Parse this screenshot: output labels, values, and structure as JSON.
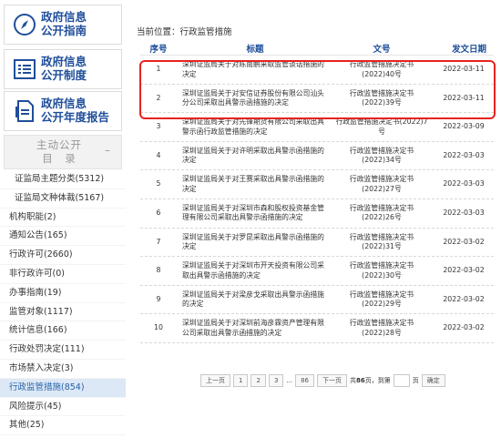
{
  "sidebar": {
    "guide": {
      "line1": "政府信息",
      "line2": "公开指南",
      "icon": "compass-icon"
    },
    "system": {
      "line1": "政府信息",
      "line2": "公开制度",
      "icon": "list-icon"
    },
    "report": {
      "line1": "政府信息",
      "line2": "公开年度报告",
      "icon": "document-icon"
    },
    "catalog": {
      "line1": "主动公开",
      "line2": "目　录",
      "collapse": "–"
    },
    "items": [
      {
        "label": "证监局主题分类(5312)"
      },
      {
        "label": "证监局文种体裁(5167)"
      },
      {
        "label": "机构职能(2)"
      },
      {
        "label": "通知公告(165)"
      },
      {
        "label": "行政许可(2660)"
      },
      {
        "label": "非行政许可(0)"
      },
      {
        "label": "办事指南(19)"
      },
      {
        "label": "监管对象(1117)"
      },
      {
        "label": "统计信息(166)"
      },
      {
        "label": "行政处罚决定(111)"
      },
      {
        "label": "市场禁入决定(3)"
      },
      {
        "label": "行政监管措施(854)"
      },
      {
        "label": "风险提示(45)"
      },
      {
        "label": "其他(25)"
      }
    ]
  },
  "breadcrumb": "当前位置：行政监管措施",
  "table": {
    "headers": {
      "no": "序号",
      "title": "标题",
      "doc": "文号",
      "date": "发文日期"
    },
    "rows": [
      {
        "no": "1",
        "title": "深圳证监局关于对陈南鹏采取监管谈话措施的决定",
        "doc": "行政监管措施决定书(2022)40号",
        "date": "2022-03-11"
      },
      {
        "no": "2",
        "title": "深圳证监局关于对安信证券股份有限公司汕头分公司采取出具警示函措施的决定",
        "doc": "行政监管措施决定书(2022)39号",
        "date": "2022-03-11"
      },
      {
        "no": "3",
        "title": "深圳证监局关于对先锋期货有限公司采取出具警示函行政监管措施的决定",
        "doc": "行政监管措施决定书(2022)7号",
        "date": "2022-03-09"
      },
      {
        "no": "4",
        "title": "深圳证监局关于对许明采取出具警示函措施的决定",
        "doc": "行政监管措施决定书(2022)34号",
        "date": "2022-03-03"
      },
      {
        "no": "5",
        "title": "深圳证监局关于对王赛采取出具警示函措施的决定",
        "doc": "行政监管措施决定书(2022)27号",
        "date": "2022-03-03"
      },
      {
        "no": "6",
        "title": "深圳证监局关于对深圳市森和股权投资基金管理有限公司采取出具警示函措施的决定",
        "doc": "行政监管措施决定书(2022)26号",
        "date": "2022-03-03"
      },
      {
        "no": "7",
        "title": "深圳证监局关于对罗昆采取出具警示函措施的决定",
        "doc": "行政监管措施决定书(2022)31号",
        "date": "2022-03-02"
      },
      {
        "no": "8",
        "title": "深圳证监局关于对深圳市开天投资有限公司采取出具警示函措施的决定",
        "doc": "行政监管措施决定书(2022)30号",
        "date": "2022-03-02"
      },
      {
        "no": "9",
        "title": "深圳证监局关于对梁彦戈采取出具警示函措施的决定",
        "doc": "行政监管措施决定书(2022)29号",
        "date": "2022-03-02"
      },
      {
        "no": "10",
        "title": "深圳证监局关于对深圳前海彦霖资产管理有限公司采取出具警示函措施的决定",
        "doc": "行政监管措施决定书(2022)28号",
        "date": "2022-03-02"
      }
    ]
  },
  "pager": {
    "prev": "上一页",
    "p1": "1",
    "p2": "2",
    "p3": "3",
    "ellipsis": "...",
    "plast": "86",
    "next": "下一页",
    "total_pre": "共",
    "total_num": "86",
    "total_post": "页，到第",
    "page_suffix": "页",
    "confirm": "确定"
  },
  "colors": {
    "accent": "#1f4e9a",
    "highlight": "#e8231e",
    "active_bg": "#dde8f6"
  }
}
